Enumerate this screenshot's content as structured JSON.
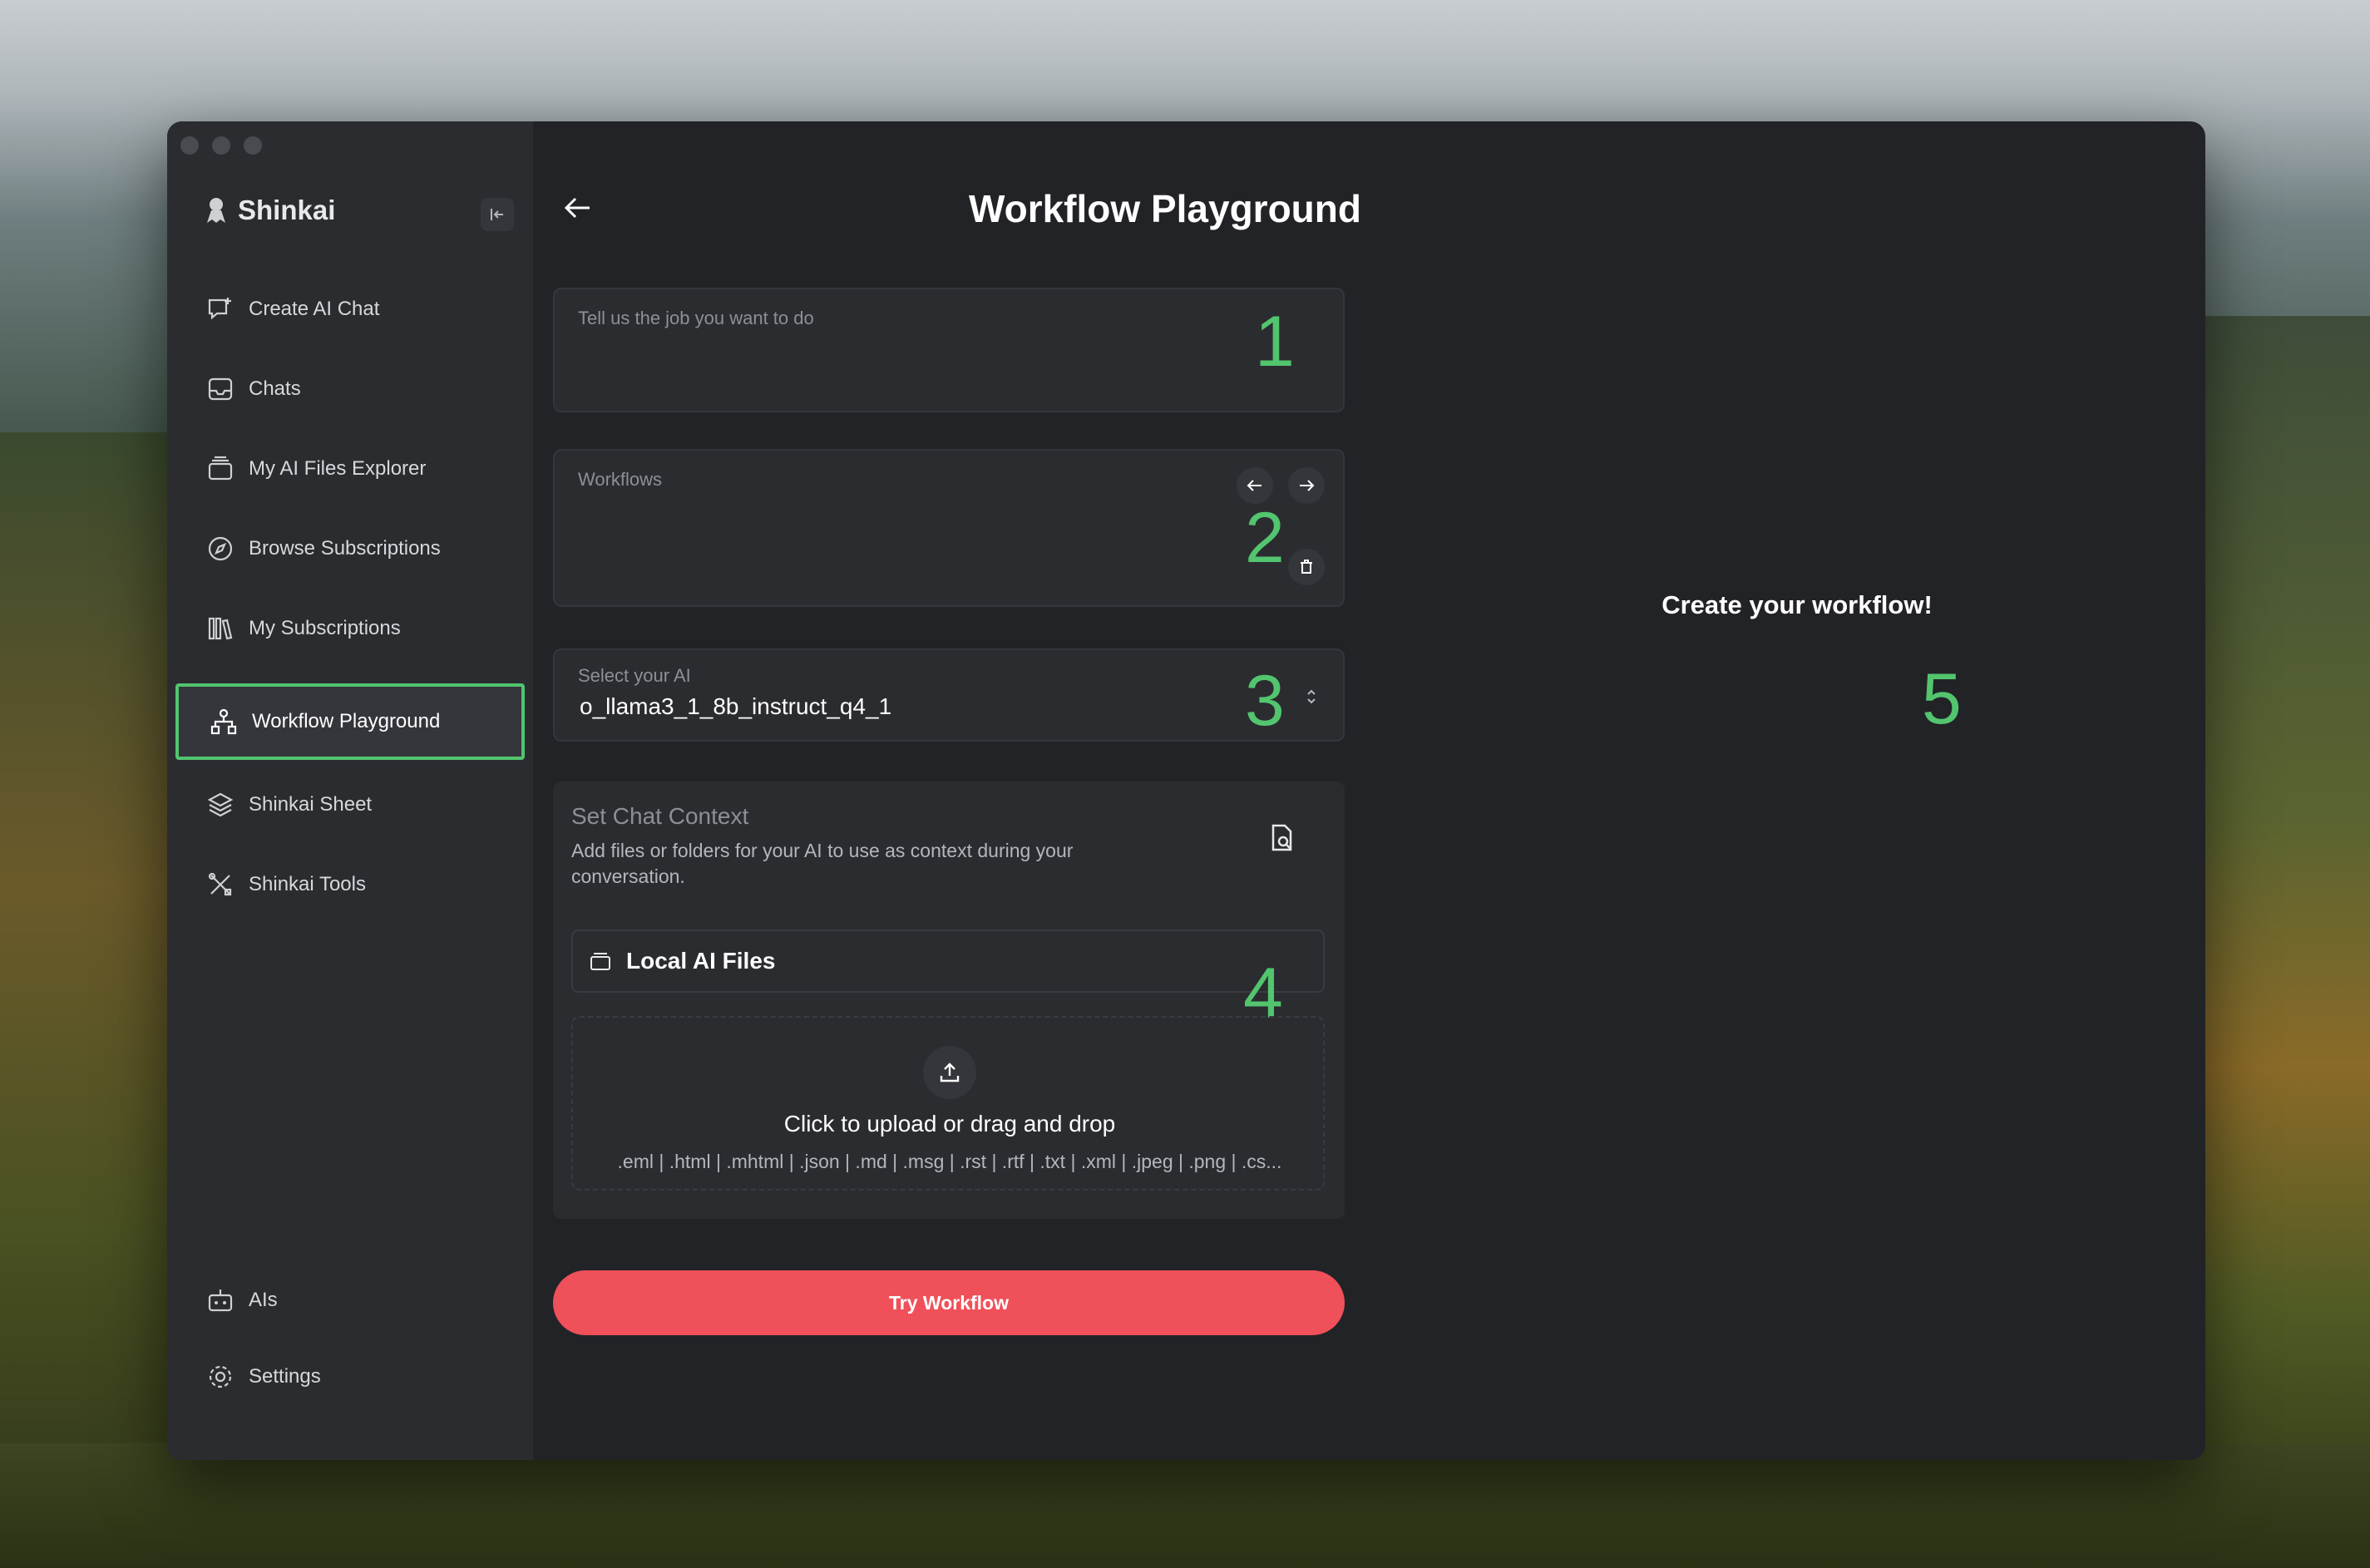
{
  "app": {
    "name": "Shinkai"
  },
  "sidebar": {
    "items": [
      {
        "label": "Create AI Chat",
        "icon": "chat-plus-icon"
      },
      {
        "label": "Chats",
        "icon": "inbox-icon"
      },
      {
        "label": "My AI Files Explorer",
        "icon": "files-icon"
      },
      {
        "label": "Browse Subscriptions",
        "icon": "compass-icon"
      },
      {
        "label": "My Subscriptions",
        "icon": "library-icon"
      },
      {
        "label": "Workflow Playground",
        "icon": "workflow-icon",
        "active": true
      },
      {
        "label": "Shinkai Sheet",
        "icon": "layers-icon"
      },
      {
        "label": "Shinkai Tools",
        "icon": "tools-icon"
      }
    ],
    "bottom_items": [
      {
        "label": "AIs",
        "icon": "robot-icon"
      },
      {
        "label": "Settings",
        "icon": "gear-icon"
      }
    ]
  },
  "main": {
    "title": "Workflow Playground",
    "job_input": {
      "placeholder": "Tell us the job you want to do",
      "step": "1"
    },
    "workflows": {
      "label": "Workflows",
      "step": "2"
    },
    "ai_select": {
      "label": "Select your AI",
      "value": "o_llama3_1_8b_instruct_q4_1",
      "step": "3"
    },
    "chat_context": {
      "title": "Set Chat Context",
      "description": "Add files or folders for your AI to use as context during your conversation.",
      "local_files_label": "Local AI Files",
      "step": "4",
      "upload_title": "Click to upload or drag and drop",
      "upload_types": ".eml | .html | .mhtml | .json | .md | .msg | .rst | .rtf | .txt | .xml | .jpeg | .png | .cs..."
    },
    "try_button": "Try Workflow",
    "output": {
      "empty_title": "Create your workflow!",
      "step": "5"
    }
  },
  "colors": {
    "accent_green": "#52c56e",
    "primary_button": "#f0505a",
    "window_bg": "#222327",
    "sidebar_bg": "#2b2c30"
  }
}
